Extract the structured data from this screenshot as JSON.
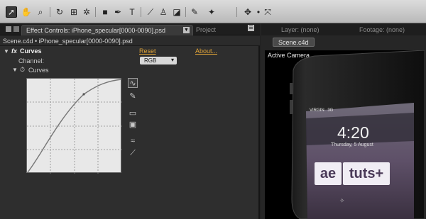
{
  "toolbar": {
    "tools": [
      "selection-tool",
      "hand-tool",
      "zoom-tool",
      "rotate-tool",
      "camera-orbit-tool",
      "pan-behind-tool",
      "rectangle-tool",
      "pen-tool",
      "type-tool",
      "brush-tool",
      "clone-stamp-tool",
      "eraser-tool",
      "roto-brush-tool",
      "puppet-pin-tool",
      "axis-mode-tool",
      "local-axis-tool",
      "world-axis-tool"
    ]
  },
  "effect_panel": {
    "tab_label": "Effect Controls: iPhone_specular[0000-0090].psd",
    "project_tab": "Project",
    "path": "Scene.c4d • iPhone_specular[0000-0090].psd",
    "effect_name": "Curves",
    "reset_label": "Reset",
    "about_label": "About...",
    "channel_label": "Channel:",
    "channel_value": "RGB",
    "curves_label": "Curves"
  },
  "viewer_panel": {
    "layer_tab": "Layer: (none)",
    "footage_tab": "Footage: (none)",
    "comp_tab": "Scene.c4d",
    "camera_label": "Active Camera",
    "phone": {
      "carrier": "VIRGIN",
      "network": "3G",
      "time": "4:20",
      "date": "Thursday, 5 August",
      "logo_left": "ae",
      "logo_right": "tuts+"
    }
  },
  "colors": {
    "accent_link": "#e1a438",
    "panel_bg": "#2e2e2e",
    "viewer_bg": "#000000"
  }
}
